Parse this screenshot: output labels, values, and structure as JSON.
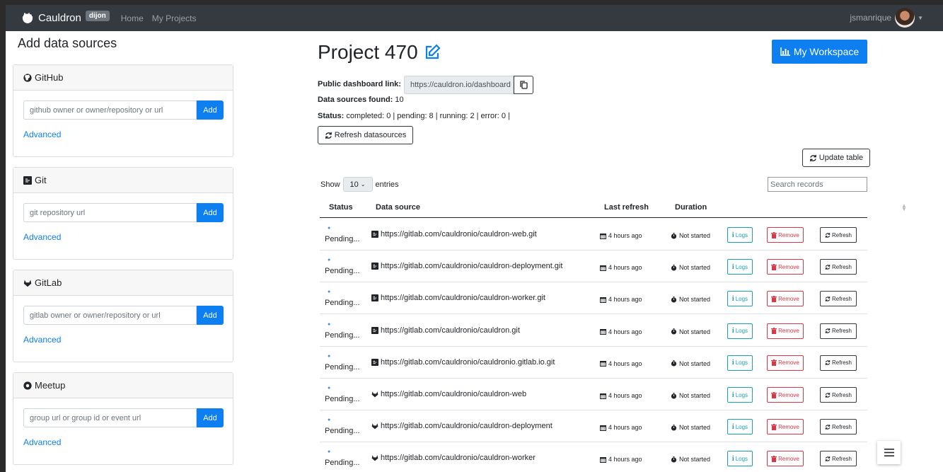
{
  "navbar": {
    "brand": "Cauldron",
    "badge": "dijon",
    "links": [
      "Home",
      "My Projects"
    ],
    "user": "jsmanrique"
  },
  "sidebar": {
    "title": "Add data sources",
    "cards": [
      {
        "name": "GitHub",
        "icon": "github-icon",
        "placeholder": "github owner or owner/repository or url",
        "add": "Add",
        "advanced": "Advanced"
      },
      {
        "name": "Git",
        "icon": "git-icon",
        "placeholder": "git repository url",
        "add": "Add",
        "advanced": "Advanced"
      },
      {
        "name": "GitLab",
        "icon": "gitlab-icon",
        "placeholder": "gitlab owner or owner/repository or url",
        "add": "Add",
        "advanced": "Advanced"
      },
      {
        "name": "Meetup",
        "icon": "meetup-icon",
        "placeholder": "group url or group id or event url",
        "add": "Add",
        "advanced": "Advanced"
      }
    ]
  },
  "project": {
    "title": "Project 470",
    "workspace_button": "My Workspace",
    "public_link_label": "Public dashboard link:",
    "public_link_value": "https://cauldron.io/dashboard",
    "sources_label": "Data sources found:",
    "sources_value": "10",
    "status_label": "Status:",
    "status_value": "completed: 0 | pending: 8 | running: 2 | error: 0 |",
    "refresh_button": "Refresh datasources",
    "update_button": "Update table"
  },
  "table": {
    "show_label": "Show",
    "show_value": "10",
    "entries_label": "entries",
    "search_placeholder": "Search records",
    "headers": {
      "status": "Status",
      "source": "Data source",
      "last": "Last refresh",
      "duration": "Duration"
    },
    "rows": [
      {
        "status": "Pending...",
        "type": "git",
        "source": "https://gitlab.com/cauldronio/cauldron-web.git",
        "last": "4 hours ago",
        "duration": "Not started"
      },
      {
        "status": "Pending...",
        "type": "git",
        "source": "https://gitlab.com/cauldronio/cauldron-deployment.git",
        "last": "4 hours ago",
        "duration": "Not started"
      },
      {
        "status": "Pending...",
        "type": "git",
        "source": "https://gitlab.com/cauldronio/cauldron-worker.git",
        "last": "4 hours ago",
        "duration": "Not started"
      },
      {
        "status": "Pending...",
        "type": "git",
        "source": "https://gitlab.com/cauldronio/cauldron.git",
        "last": "4 hours ago",
        "duration": "Not started"
      },
      {
        "status": "Pending...",
        "type": "git",
        "source": "https://gitlab.com/cauldronio/cauldronio.gitlab.io.git",
        "last": "4 hours ago",
        "duration": "Not started"
      },
      {
        "status": "Pending...",
        "type": "gitlab",
        "source": "https://gitlab.com/cauldronio/cauldron-web",
        "last": "4 hours ago",
        "duration": "Not started"
      },
      {
        "status": "Pending...",
        "type": "gitlab",
        "source": "https://gitlab.com/cauldronio/cauldron-deployment",
        "last": "4 hours ago",
        "duration": "Not started"
      },
      {
        "status": "Pending...",
        "type": "gitlab",
        "source": "https://gitlab.com/cauldronio/cauldron-worker",
        "last": "4 hours ago",
        "duration": "Not started"
      }
    ],
    "actions": {
      "logs": "Logs",
      "remove": "Remove",
      "refresh": "Refresh"
    }
  },
  "colors": {
    "primary": "#0d7ff0",
    "navbar": "#343a40",
    "info": "#17a2b8",
    "danger": "#dc3545"
  }
}
